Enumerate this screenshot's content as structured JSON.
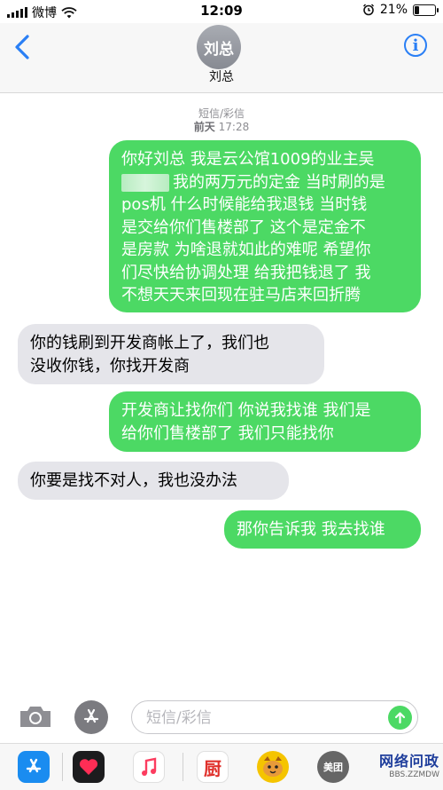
{
  "status_bar": {
    "carrier": "微博",
    "time": "12:09",
    "battery_percent": "21%",
    "battery_level": 0.21
  },
  "nav": {
    "avatar_text": "刘总",
    "contact_name": "刘总",
    "info_label": "i"
  },
  "conversation": {
    "service": "短信/彩信",
    "timestamp_day": "前天",
    "timestamp_time": "17:28"
  },
  "messages": [
    {
      "direction": "outgoing",
      "lines": [
        "你好刘总 我是云公馆1009的业主吴",
        "我的两万元的定金 当时刷的是",
        "pos机 什么时候能给我退钱 当时钱",
        "是交给你们售楼部了 这个是定金不",
        "是房款 为啥退就如此的难呢 希望你",
        "们尽快给协调处理 给我把钱退了 我",
        "不想天天来回现在驻马店来回折腾"
      ]
    },
    {
      "direction": "incoming",
      "lines": [
        "你的钱刷到开发商帐上了，我们也",
        "没收你钱，你找开发商"
      ]
    },
    {
      "direction": "outgoing",
      "lines": [
        "开发商让找你们 你说我找谁 我们是",
        "给你们售楼部了 我们只能找你"
      ]
    },
    {
      "direction": "incoming",
      "lines": [
        "你要是找不对人，我也没办法"
      ]
    },
    {
      "direction": "outgoing",
      "lines": [
        "那你告诉我 我去找谁"
      ]
    }
  ],
  "input_bar": {
    "placeholder": "短信/彩信",
    "send_icon": "arrow-up-icon",
    "camera_icon": "camera-icon",
    "apps_icon": "app-store-icon"
  },
  "app_drawer": {
    "apps": [
      {
        "name": "app-store",
        "color": "#1a8cf0",
        "glyph": "A"
      },
      {
        "name": "heart-app",
        "color": "#1c1c1e",
        "glyph": "♥"
      },
      {
        "name": "music",
        "color": "#ffffff",
        "glyph": "♫"
      },
      {
        "name": "chef-app",
        "color": "#ffffff",
        "glyph": "厨"
      },
      {
        "name": "cat-sticker-app",
        "color": "#f5c400",
        "glyph": "🐱"
      },
      {
        "name": "meituan-app",
        "color": "#666666",
        "glyph": "美团"
      }
    ],
    "watermark_text": "网络问政",
    "watermark_sub": "BBS.ZZMDW"
  },
  "colors": {
    "outgoing_bubble": "#4cd964",
    "incoming_bubble": "#e5e5ea",
    "accent": "#2a7ff5"
  }
}
